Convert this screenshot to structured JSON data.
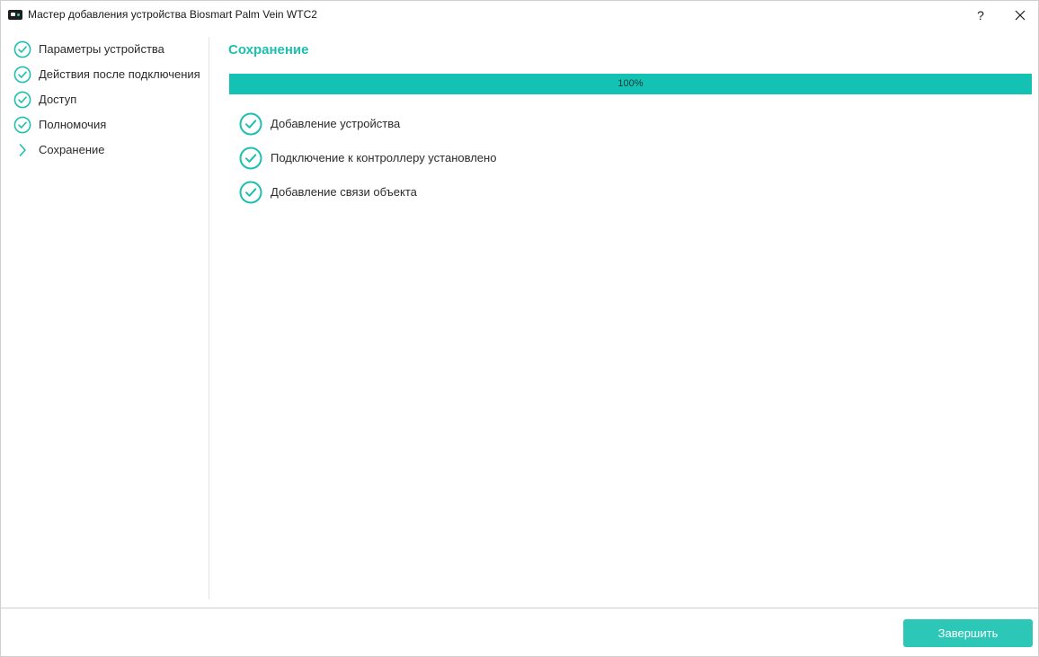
{
  "window": {
    "title": "Мастер добавления устройства Biosmart Palm Vein WTC2",
    "help_label": "?"
  },
  "sidebar": {
    "steps": [
      {
        "label": "Параметры устройства",
        "state": "done",
        "icon": "check-circle-icon"
      },
      {
        "label": "Действия после подключения",
        "state": "done",
        "icon": "check-circle-icon"
      },
      {
        "label": "Доступ",
        "state": "done",
        "icon": "check-circle-icon"
      },
      {
        "label": "Полномочия",
        "state": "done",
        "icon": "check-circle-icon"
      },
      {
        "label": "Сохранение",
        "state": "current",
        "icon": "chevron-right-icon"
      }
    ]
  },
  "main": {
    "title": "Сохранение",
    "progress": {
      "value": 100,
      "text": "100%"
    },
    "tasks": [
      {
        "label": "Добавление устройства",
        "icon": "check-circle-icon"
      },
      {
        "label": "Подключение к контроллеру установлено",
        "icon": "check-circle-icon"
      },
      {
        "label": "Добавление связи объекта",
        "icon": "check-circle-icon"
      }
    ]
  },
  "footer": {
    "finish_label": "Завершить"
  },
  "colors": {
    "accent": "#1fbfb0",
    "progress": "#13c2b2",
    "button": "#2cc7b7"
  }
}
